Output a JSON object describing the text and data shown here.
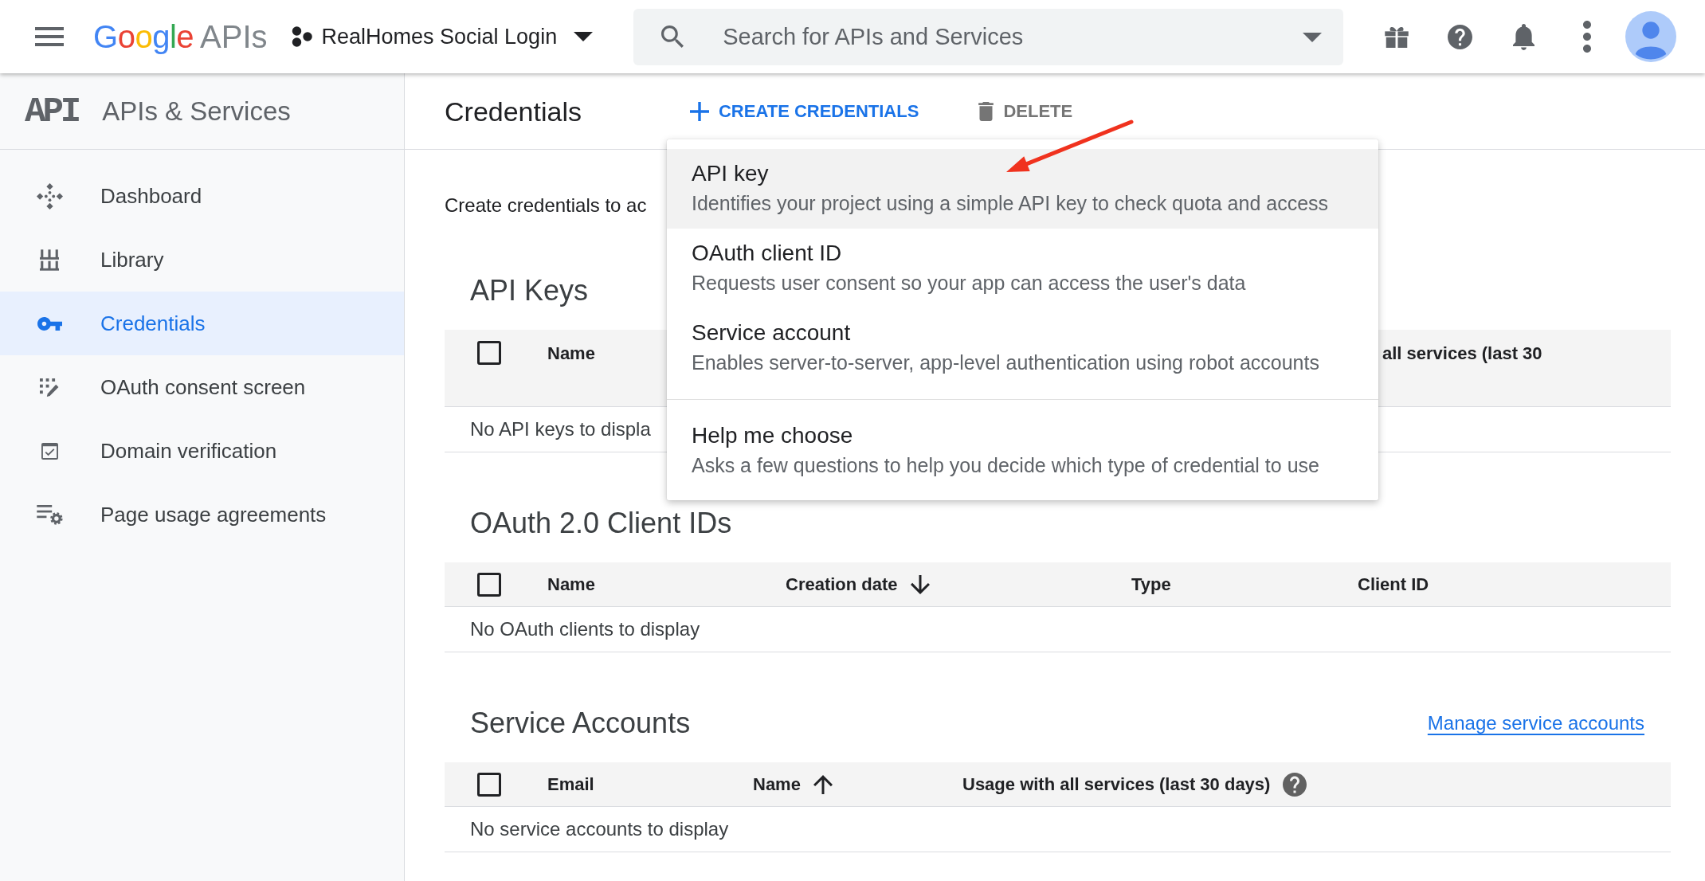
{
  "top_bar": {
    "logo": {
      "brand": "Google",
      "product": "APIs"
    },
    "project": "RealHomes Social Login",
    "search": {
      "placeholder": "Search for APIs and Services"
    }
  },
  "sidebar": {
    "logo": "API",
    "title": "APIs & Services",
    "items": [
      {
        "label": "Dashboard",
        "selected": false
      },
      {
        "label": "Library",
        "selected": false
      },
      {
        "label": "Credentials",
        "selected": true
      },
      {
        "label": "OAuth consent screen",
        "selected": false
      },
      {
        "label": "Domain verification",
        "selected": false
      },
      {
        "label": "Page usage agreements",
        "selected": false
      }
    ]
  },
  "header": {
    "title": "Credentials",
    "actions": [
      {
        "label": "CREATE CREDENTIALS",
        "disabled": false
      },
      {
        "label": "DELETE",
        "disabled": true
      }
    ]
  },
  "intro": "Create credentials to ac",
  "sections": [
    {
      "kind": "api_keys",
      "title": "API Keys",
      "select_all_checked": false,
      "columns": [
        {
          "label": "Name",
          "sorted_asc": false,
          "sorted_desc": false,
          "help_icon": false
        },
        {
          "label": "all services (last 30",
          "sorted_asc": false,
          "sorted_desc": false,
          "help_icon": false
        }
      ],
      "empty_message": "No API keys to displa"
    },
    {
      "kind": "oauth_clients",
      "title": "OAuth 2.0 Client IDs",
      "select_all_checked": false,
      "columns": [
        {
          "label": "Name",
          "sorted_asc": false,
          "sorted_desc": false,
          "help_icon": false
        },
        {
          "label": "Creation date",
          "sorted_asc": false,
          "sorted_desc": true,
          "help_icon": false
        },
        {
          "label": "Type",
          "sorted_asc": false,
          "sorted_desc": false,
          "help_icon": false
        },
        {
          "label": "Client ID",
          "sorted_asc": false,
          "sorted_desc": false,
          "help_icon": false
        }
      ],
      "empty_message": "No OAuth clients to display"
    },
    {
      "kind": "service_accounts",
      "title": "Service Accounts",
      "link": "Manage service accounts",
      "select_all_checked": false,
      "columns": [
        {
          "label": "Email",
          "sorted_asc": false,
          "sorted_desc": false,
          "help_icon": false
        },
        {
          "label": "Name",
          "sorted_asc": true,
          "sorted_desc": false,
          "help_icon": false
        },
        {
          "label": "Usage with all services (last 30 days)",
          "sorted_asc": false,
          "sorted_desc": false,
          "help_icon": true
        }
      ],
      "empty_message": "No service accounts to display"
    }
  ],
  "menu": {
    "items": [
      {
        "title": "API key",
        "description": "Identifies your project using a simple API key to check quota and access",
        "highlighted": true,
        "separated": false
      },
      {
        "title": "OAuth client ID",
        "description": "Requests user consent so your app can access the user's data",
        "highlighted": false,
        "separated": false
      },
      {
        "title": "Service account",
        "description": "Enables server-to-server, app-level authentication using robot accounts",
        "highlighted": false,
        "separated": false
      },
      {
        "title": "Help me choose",
        "description": "Asks a few questions to help you decide which type of credential to use",
        "highlighted": false,
        "separated": true
      }
    ]
  }
}
